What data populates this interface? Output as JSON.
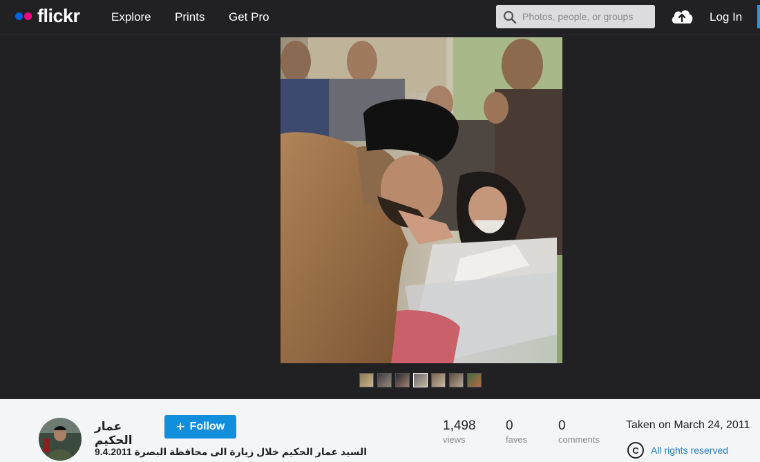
{
  "header": {
    "logo": "flickr",
    "nav": [
      "Explore",
      "Prints",
      "Get Pro"
    ],
    "search_placeholder": "Photos, people, or groups",
    "login": "Log In"
  },
  "photo": {
    "thumbnail_count": 7
  },
  "info": {
    "author": "عمار الحكيم",
    "follow_label": "Follow",
    "caption": "السيد عمار الحكيم خلال زيارة الى محافظة البصرة 9.4.2011",
    "stats": {
      "views": {
        "value": "1,498",
        "label": "views"
      },
      "faves": {
        "value": "0",
        "label": "faves"
      },
      "comments": {
        "value": "0",
        "label": "comments"
      }
    },
    "taken": "Taken on March 24, 2011",
    "rights": "All rights reserved"
  },
  "colors": {
    "nav_bg": "#212124",
    "accent_blue": "#128fdc",
    "logo_blue": "#0063dc",
    "logo_pink": "#ff0084",
    "info_bg": "#f3f5f6"
  }
}
